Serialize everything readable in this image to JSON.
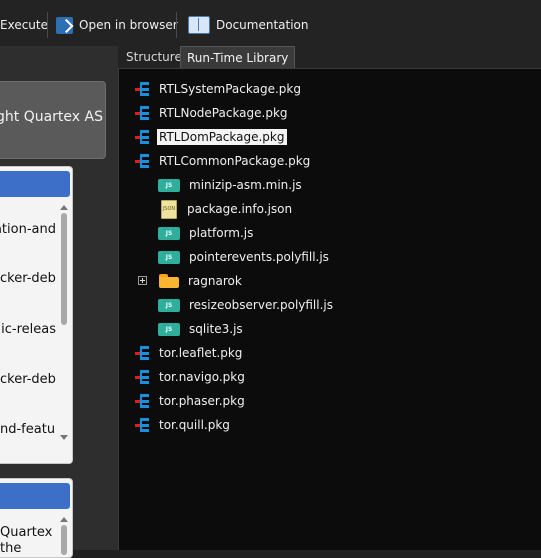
{
  "toolbar": {
    "execute_label": "Execute",
    "open_browser_label": "Open in browser",
    "documentation_label": "Documentation"
  },
  "left": {
    "banner_text": "right Quartex AS",
    "card1_lines": [
      "ation-and",
      "cker-deb",
      "lic-releas",
      "cker-deb",
      "nd-featu"
    ],
    "card2_lines": [
      "Quartex",
      "the"
    ]
  },
  "tabs": [
    {
      "label": "Structure",
      "active": false
    },
    {
      "label": "Run-Time Library",
      "active": true
    }
  ],
  "tree": {
    "packages_top": [
      {
        "label": "RTLSystemPackage.pkg",
        "icon": "package-icon"
      },
      {
        "label": "RTLNodePackage.pkg",
        "icon": "package-icon"
      },
      {
        "label": "RTLDomPackage.pkg",
        "icon": "package-icon",
        "selected": true
      },
      {
        "label": "RTLCommonPackage.pkg",
        "icon": "package-icon"
      }
    ],
    "children": [
      {
        "label": "minizip-asm.min.js",
        "icon": "js-file-icon",
        "badge": "JS"
      },
      {
        "label": "package.info.json",
        "icon": "json-file-icon",
        "badge": "JSON"
      },
      {
        "label": "platform.js",
        "icon": "js-file-icon",
        "badge": "JS"
      },
      {
        "label": "pointerevents.polyfill.js",
        "icon": "js-file-icon",
        "badge": "JS"
      },
      {
        "label": "ragnarok",
        "icon": "folder-icon",
        "expandable": true
      },
      {
        "label": "resizeobserver.polyfill.js",
        "icon": "js-file-icon",
        "badge": "JS"
      },
      {
        "label": "sqlite3.js",
        "icon": "js-file-icon",
        "badge": "JS"
      }
    ],
    "packages_bottom": [
      {
        "label": "tor.leaflet.pkg",
        "icon": "package-icon"
      },
      {
        "label": "tor.navigo.pkg",
        "icon": "package-icon"
      },
      {
        "label": "tor.phaser.pkg",
        "icon": "package-icon"
      },
      {
        "label": "tor.quill.pkg",
        "icon": "package-icon"
      }
    ]
  },
  "colors": {
    "package_icon": "#1a8fe0",
    "package_dot": "#e02020",
    "js_badge": "#2fae9e",
    "folder": "#f7b531",
    "card_header": "#3d6fc8"
  }
}
